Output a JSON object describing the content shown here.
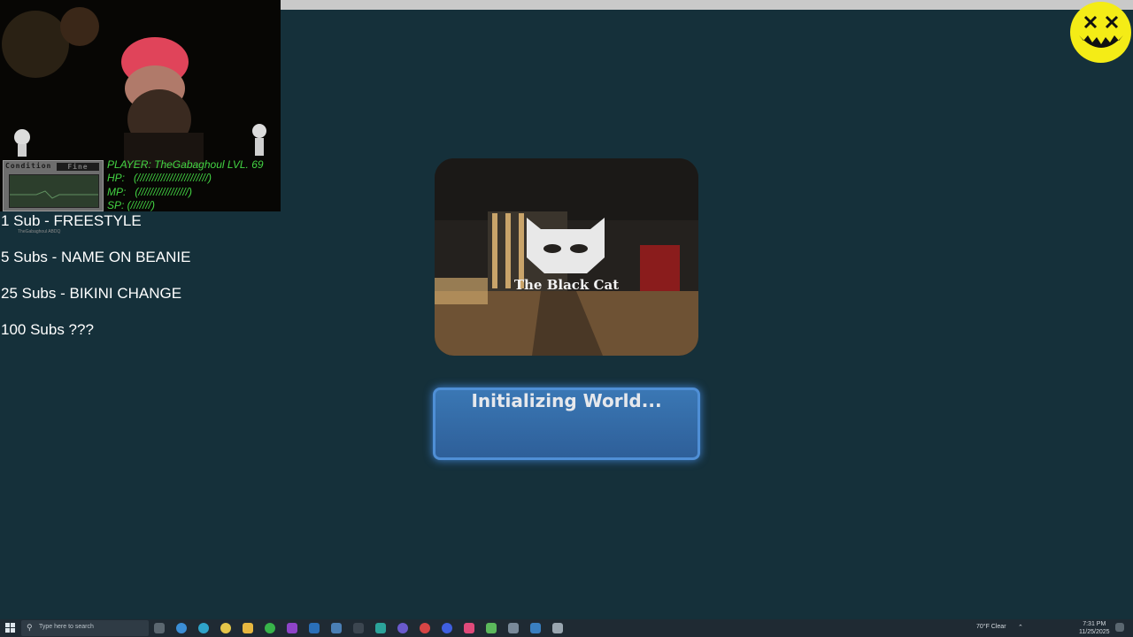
{
  "overlay": {
    "condition_label": "Condition",
    "condition_value": "Fine",
    "stats": {
      "player": "PLAYER: TheGabaghoul LVL. 69",
      "hp": "HP:   (////////////////////////)",
      "mp": "MP:   (/////////////////)",
      "sp": "SP: (///////)"
    },
    "footer": "TheGabaghoul   ABDQ"
  },
  "sub_goals": [
    "1 Sub - FREESTYLE",
    "5 Subs - NAME ON BEANIE",
    "25 Subs - BIKINI CHANGE",
    "100 Subs ???"
  ],
  "world_card": {
    "title": "The Black Cat"
  },
  "status_button": {
    "label": "Initializing World..."
  },
  "taskbar": {
    "search_placeholder": "Type here to search",
    "weather": "70°F  Clear",
    "time": "7:31 PM",
    "date": "11/25/2025"
  },
  "colors": {
    "background": "#15303a",
    "button": "#3a77b4",
    "stats_text": "#43d443",
    "logo": "#f4ec16"
  },
  "icons": [
    "windows-start-icon",
    "search-icon",
    "task-view-icon",
    "chrome-icon",
    "edge-icon",
    "file-explorer-icon",
    "smiley-logo-icon"
  ]
}
